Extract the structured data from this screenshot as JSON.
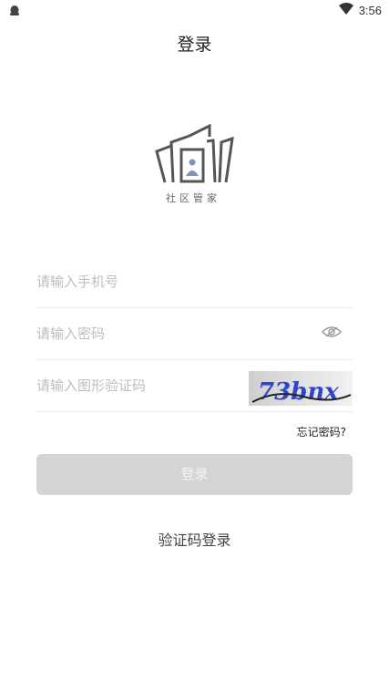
{
  "status": {
    "time": "3:56"
  },
  "header": {
    "title": "登录"
  },
  "logo": {
    "text": "社区管家"
  },
  "form": {
    "phone_placeholder": "请输入手机号",
    "password_placeholder": "请输入密码",
    "captcha_placeholder": "请输入图形验证码",
    "captcha_image_text": "73bnx",
    "forgot_label": "忘记密码?"
  },
  "actions": {
    "login_label": "登录",
    "sms_login_label": "验证码登录"
  },
  "colors": {
    "button_disabled": "#d4d4d4",
    "placeholder": "#bdbdbd",
    "logo_gray": "#555555",
    "logo_accent": "#7f93b8"
  }
}
